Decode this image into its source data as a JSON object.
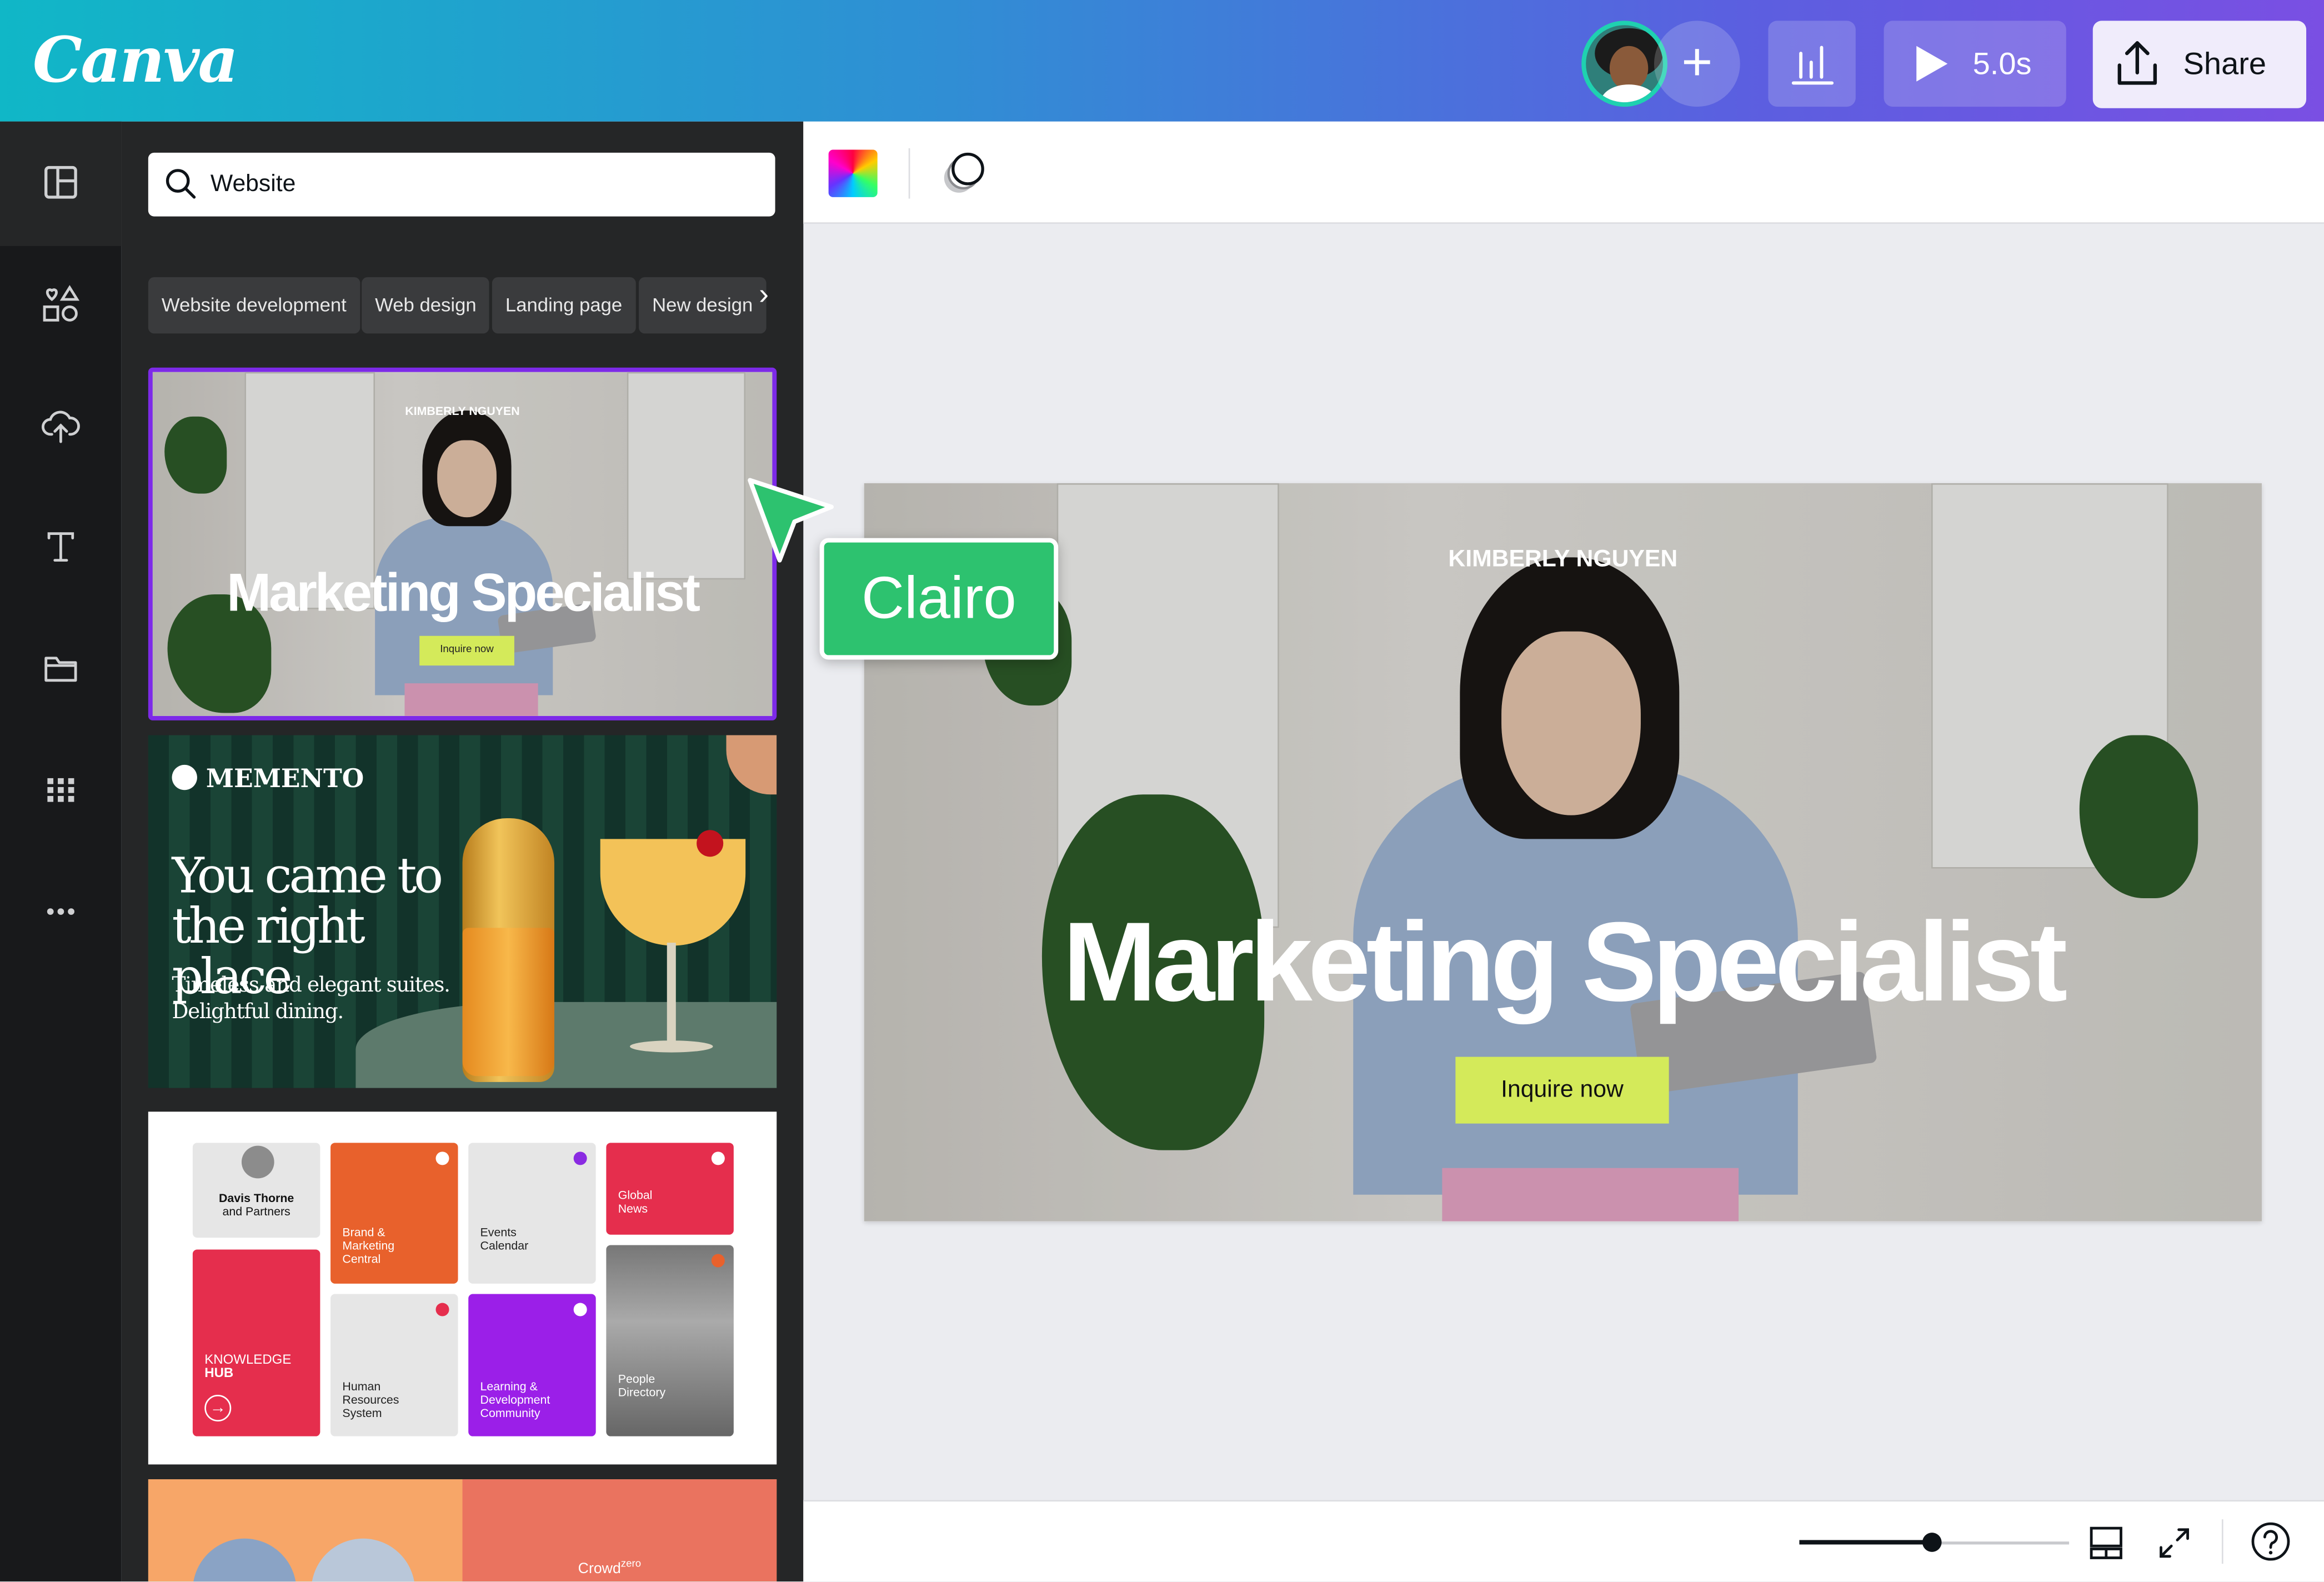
{
  "app": {
    "logo_text": "Canva"
  },
  "topbar": {
    "avatar_icon": "user-avatar",
    "add_icon": "plus-icon",
    "stats_icon": "bar-chart-icon",
    "play_duration": "5.0s",
    "share_label": "Share"
  },
  "rail": {
    "items": [
      {
        "name": "templates",
        "icon": "layout-icon"
      },
      {
        "name": "elements",
        "icon": "shapes-icon"
      },
      {
        "name": "uploads",
        "icon": "cloud-upload-icon"
      },
      {
        "name": "text",
        "icon": "text-icon"
      },
      {
        "name": "projects",
        "icon": "folder-icon"
      },
      {
        "name": "apps",
        "icon": "grid-icon"
      },
      {
        "name": "more",
        "icon": "more-icon"
      }
    ]
  },
  "search": {
    "value": "Website"
  },
  "chips": [
    "Website development",
    "Web design",
    "Landing page",
    "New design"
  ],
  "templates": {
    "card1": {
      "name": "KIMBERLY NGUYEN",
      "title": "Marketing Specialist",
      "button": "Inquire now"
    },
    "card2": {
      "logo": "MEMENTO",
      "headline_1": "You came to",
      "headline_2": "the right place",
      "sub_1": "Timeless and elegant suites.",
      "sub_2": "Delightful dining."
    },
    "card3": {
      "profile_name": "Davis Thorne",
      "profile_sub": "and Partners",
      "tiles": [
        "Brand & Marketing Central",
        "Events Calendar",
        "Global News",
        "KNOWLEDGE",
        "HUB",
        "Human Resources System",
        "Learning & Development Community",
        "People Directory"
      ]
    },
    "card4": {
      "brand": "Crowd",
      "brand_sup": "zero"
    }
  },
  "canvas": {
    "name": "KIMBERLY NGUYEN",
    "title": "Marketing Specialist",
    "button": "Inquire now"
  },
  "collaborator": {
    "name": "Clairo",
    "color": "#2dc26f"
  },
  "bottombar": {
    "zoom_fraction": 0.49
  },
  "colors": {
    "accent": "#7d2ae8",
    "cta": "#d4ea5a",
    "panel": "#252627"
  }
}
